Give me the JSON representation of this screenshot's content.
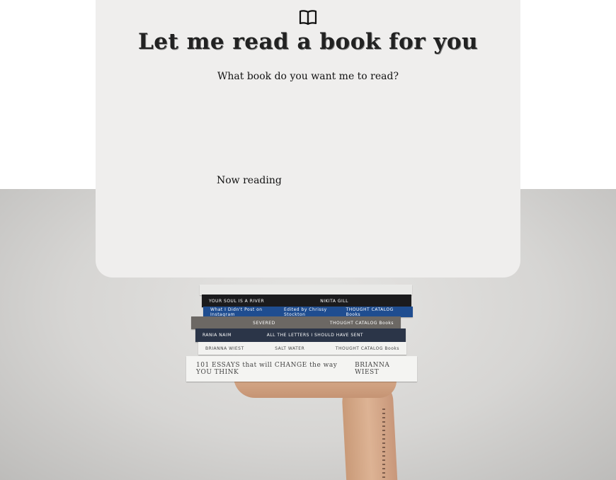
{
  "header": {
    "icon": "open-book-icon",
    "title": "Let me read a book for you",
    "subtitle": "What book do you want me to read?"
  },
  "status": {
    "now_reading_label": "Now reading"
  },
  "illustration": {
    "books": [
      {
        "left": "",
        "middle": "",
        "right": ""
      },
      {
        "left": "YOUR SOUL IS A RIVER",
        "middle": "NIKITA GILL",
        "right": ""
      },
      {
        "left": "What I Didn't Post on Instagram",
        "middle": "Edited by Chrissy Stockton",
        "right": "THOUGHT CATALOG Books"
      },
      {
        "left": "",
        "middle": "SEVERED",
        "right": "THOUGHT CATALOG Books"
      },
      {
        "left": "RANIA NAIM",
        "middle": "ALL THE LETTERS I SHOULD HAVE SENT",
        "right": ""
      },
      {
        "left": "BRIANNA WIEST",
        "middle": "SALT WATER",
        "right": "THOUGHT CATALOG Books"
      },
      {
        "left": "101 ESSAYS that will CHANGE the way YOU THINK",
        "middle": "",
        "right": "BRIANNA WIEST"
      }
    ]
  },
  "colors": {
    "card_background": "#efeeed",
    "page_background": "#ffffff"
  }
}
